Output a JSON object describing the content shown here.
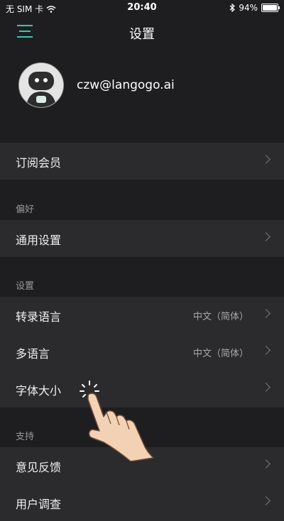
{
  "status_bar": {
    "carrier": "无 SIM 卡",
    "time": "20:40",
    "battery": "94%"
  },
  "nav": {
    "title": "设置"
  },
  "profile": {
    "email": "czw@langogo.ai"
  },
  "sections": {
    "subscription": {
      "label": "订阅会员"
    },
    "preferences": {
      "header": "偏好",
      "general": "通用设置"
    },
    "settings": {
      "header": "设置",
      "transcription_language": {
        "label": "转录语言",
        "value": "中文（简体）"
      },
      "multilingual": {
        "label": "多语言",
        "value": "中文（简体）"
      },
      "font_size": {
        "label": "字体大小"
      }
    },
    "support": {
      "header": "支持",
      "feedback": "意见反馈",
      "survey": "用户调查"
    }
  },
  "colors": {
    "accent": "#34c8b0",
    "background": "#1e1e20",
    "row": "#2b2b2e"
  },
  "icons": [
    "hamburger-menu-icon",
    "wifi-icon",
    "bluetooth-icon",
    "battery-icon",
    "chevron-right-icon",
    "tap-hand-icon"
  ]
}
